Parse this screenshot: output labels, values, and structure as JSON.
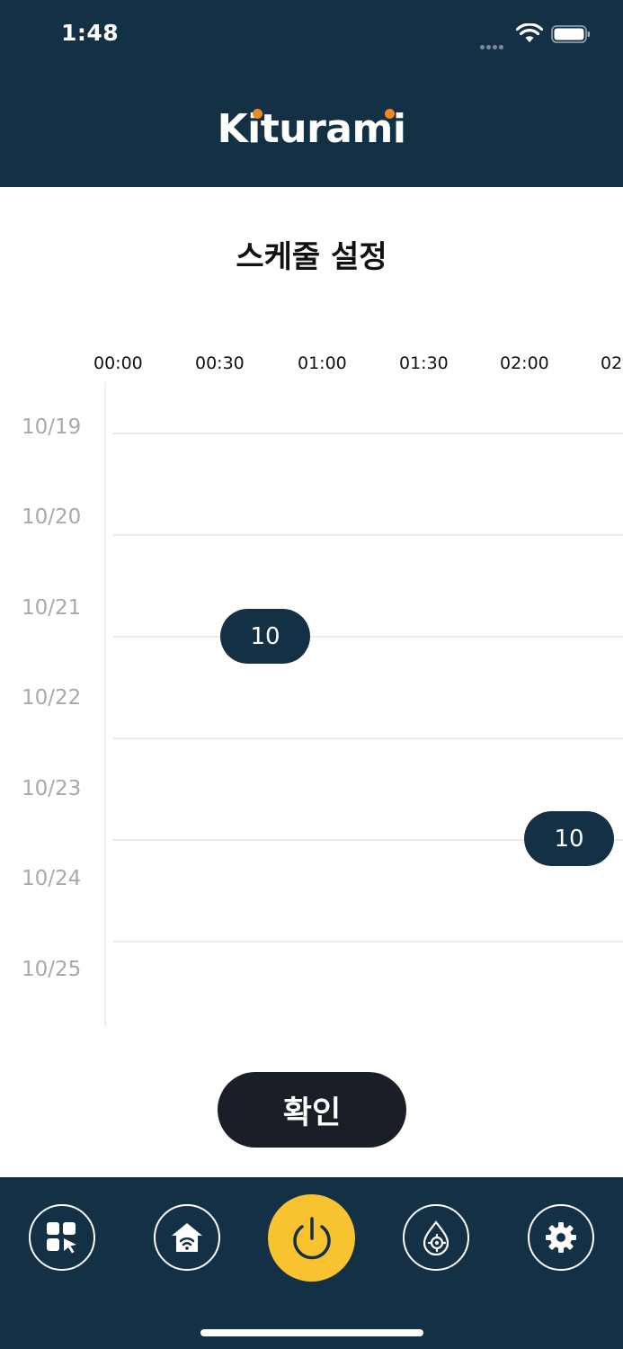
{
  "status_bar": {
    "time": "1:48"
  },
  "header": {
    "logo_text": "Kiturami"
  },
  "page": {
    "title": "스케줄 설정"
  },
  "schedule": {
    "time_columns": [
      "00:00",
      "00:30",
      "01:00",
      "01:30",
      "02:00",
      "02"
    ],
    "dates": [
      "10/19",
      "10/20",
      "10/21",
      "10/22",
      "10/23",
      "10/24",
      "10/25"
    ],
    "entries": [
      {
        "value": "10"
      },
      {
        "value": "10"
      }
    ]
  },
  "actions": {
    "confirm_label": "확인"
  },
  "nav": {
    "items": [
      {
        "icon": "grid-cursor-icon"
      },
      {
        "icon": "home-wifi-icon"
      },
      {
        "icon": "power-icon"
      },
      {
        "icon": "water-gear-icon"
      },
      {
        "icon": "gear-icon"
      }
    ]
  },
  "colors": {
    "primary": "#133045",
    "accent": "#f7c331",
    "logo_dot": "#f08a1e"
  }
}
